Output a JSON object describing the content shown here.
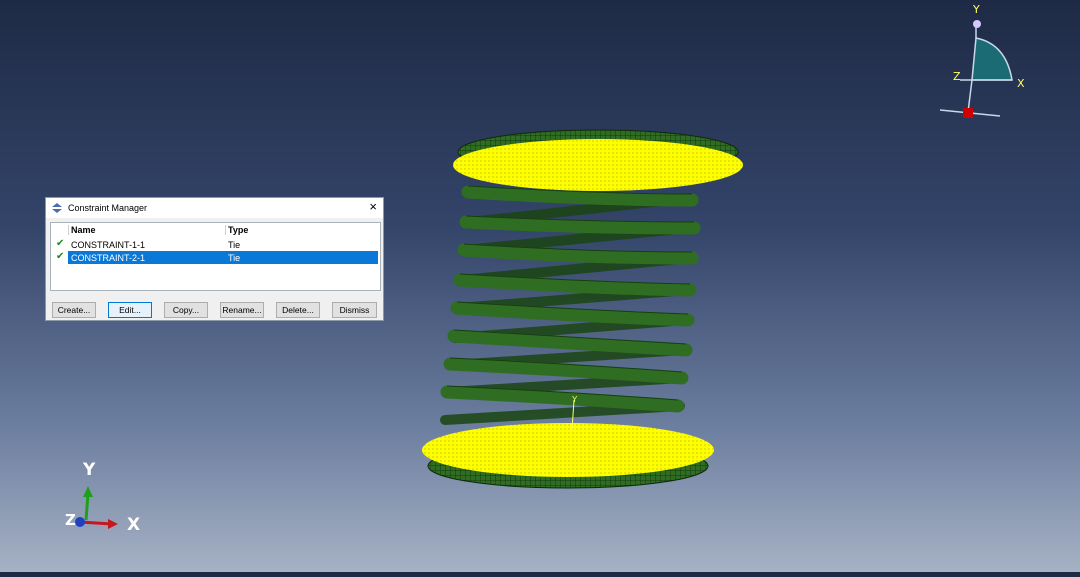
{
  "dialog": {
    "title": "Constraint Manager",
    "close": "×",
    "columns": {
      "name": "Name",
      "type": "Type"
    },
    "rows": [
      {
        "name": "CONSTRAINT-1-1",
        "type": "Tie",
        "active": "✔",
        "selected": false
      },
      {
        "name": "CONSTRAINT-2-1",
        "type": "Tie",
        "active": "✔",
        "selected": true
      }
    ],
    "buttons": {
      "create": "Create...",
      "edit": "Edit...",
      "copy": "Copy...",
      "rename": "Rename...",
      "delete": "Delete...",
      "dismiss": "Dismiss"
    }
  },
  "triad_bottom": {
    "y": "Y",
    "z": "Z",
    "x": "X"
  },
  "view_cube": {
    "y": "Y",
    "z": "Z",
    "x": "X"
  },
  "model_label": "Y",
  "colors": {
    "background_top": "#1e2a45",
    "background_bottom": "#a6b1c4",
    "spring_mesh": "#2d6b1f",
    "surface_highlight": "#ffff00",
    "selection": "#0a78d7",
    "check": "#1b8a1b"
  }
}
